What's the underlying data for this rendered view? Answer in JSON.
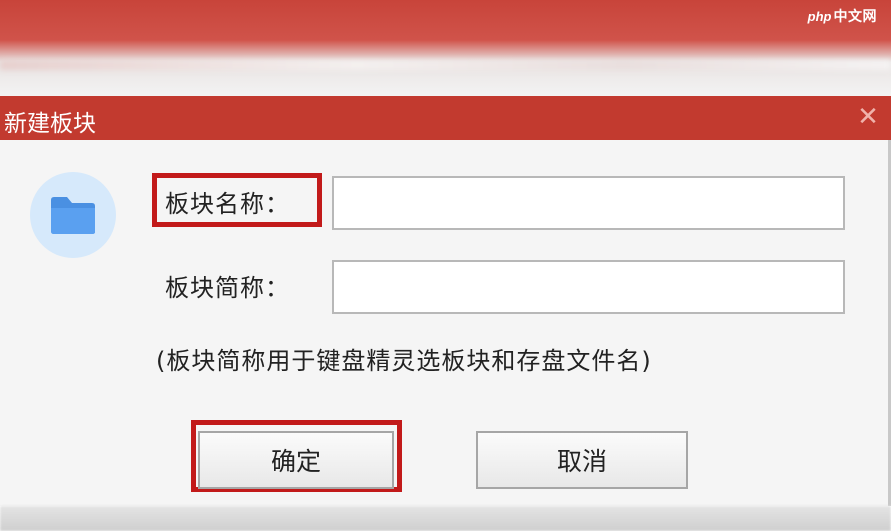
{
  "watermark": {
    "php": "php",
    "site": "中文网"
  },
  "dialog": {
    "title": "新建板块",
    "close_glyph": "✕",
    "icon": "folder-icon",
    "name_label": "板块名称：",
    "name_value": "",
    "abbr_label": "板块简称：",
    "abbr_value": "",
    "hint": "(板块简称用于键盘精灵选板块和存盘文件名)",
    "ok_label": "确定",
    "cancel_label": "取消"
  },
  "colors": {
    "titlebar": "#c23a2f",
    "highlight": "#c21a1a",
    "folder": "#4a90e2",
    "folder_bg": "#d6e9fb"
  }
}
